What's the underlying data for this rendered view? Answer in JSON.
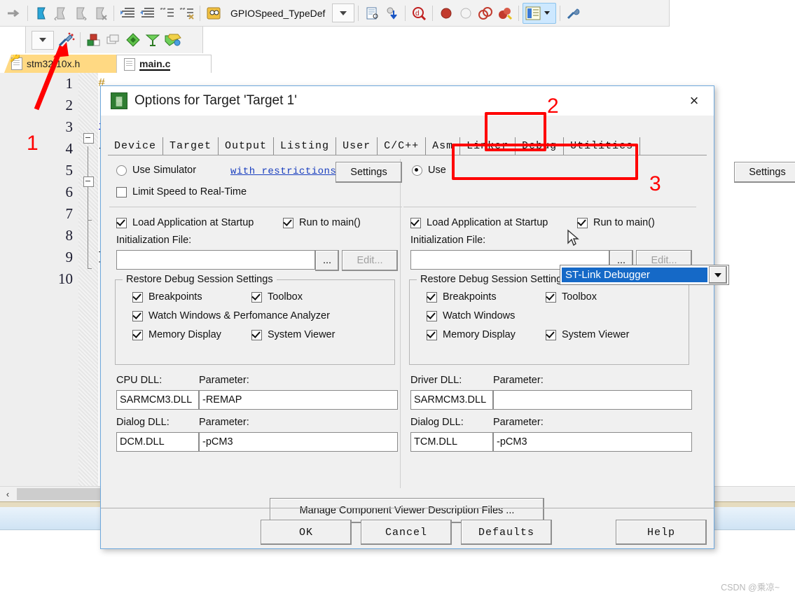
{
  "toolbar": {
    "combo_label": "GPIOSpeed_TypeDef",
    "icons_row1": [
      "step-arrow-icon",
      "bookmark-blue-icon",
      "bookmark-prev-icon",
      "bookmark-next-icon",
      "bookmark-clear-icon",
      "indent-icon",
      "outdent-icon",
      "comment-icon",
      "uncomment-icon",
      "find-in-files-icon"
    ],
    "icons_row1b": [
      "document-properties-icon",
      "insert-icon",
      "find-target-icon",
      "breakpoint-icon",
      "breakpoint-disable-icon",
      "breakpoint-toggle-icon",
      "breakpoint-kill-icon",
      "project-window-icon",
      "configure-wizard-icon"
    ],
    "icons_row2": [
      "dropdown-icon",
      "build-wizard-icon",
      "target-options-icon",
      "manage-project-icon",
      "batch-build-icon",
      "translate-icon",
      "manage-runtime-icon"
    ]
  },
  "file_tabs": [
    {
      "name": "stm32f10x.h",
      "icon": "key-document-icon",
      "active": false
    },
    {
      "name": "main.c",
      "icon": "document-icon",
      "active": true
    }
  ],
  "editor": {
    "line_numbers": [
      "1",
      "2",
      "3",
      "4",
      "5",
      "6",
      "7",
      "8",
      "9",
      "10"
    ],
    "code_lines": [
      "#",
      "",
      "i",
      "{",
      "",
      "",
      "",
      "",
      "}",
      ""
    ],
    "scroll_left_arrow": "‹"
  },
  "dialog": {
    "title": "Options for Target 'Target 1'",
    "title_icon": "keil-logo-icon",
    "close_icon": "×",
    "tabs": [
      {
        "label": "Device",
        "active": false
      },
      {
        "label": "Target",
        "active": false
      },
      {
        "label": "Output",
        "active": false
      },
      {
        "label": "Listing",
        "active": false
      },
      {
        "label": "User",
        "active": false
      },
      {
        "label": "C/C++",
        "active": false
      },
      {
        "label": "Asm",
        "active": false
      },
      {
        "label": "Linker",
        "active": false
      },
      {
        "label": "Debug",
        "active": true
      },
      {
        "label": "Utilities",
        "active": false
      }
    ],
    "left": {
      "use_simulator_label": "Use Simulator",
      "use_simulator_checked": false,
      "with_restrictions_link": "with restrictions",
      "settings_label": "Settings",
      "limit_speed_label": "Limit Speed to Real-Time",
      "limit_speed_checked": false,
      "load_app_label": "Load Application at Startup",
      "load_app_checked": true,
      "run_to_main_label": "Run to main()",
      "run_to_main_checked": true,
      "init_file_label": "Initialization File:",
      "init_file_value": "",
      "browse_label": "...",
      "edit_label": "Edit...",
      "restore_group_title": "Restore Debug Session Settings",
      "restore_items": [
        {
          "label": "Breakpoints",
          "checked": true
        },
        {
          "label": "Toolbox",
          "checked": true
        },
        {
          "label": "Watch Windows & Perfomance Analyzer",
          "checked": true
        },
        {
          "label": "Memory Display",
          "checked": true
        },
        {
          "label": "System Viewer",
          "checked": true
        }
      ],
      "cpu_dll_label": "CPU DLL:",
      "cpu_dll_value": "SARMCM3.DLL",
      "cpu_param_label": "Parameter:",
      "cpu_param_value": "-REMAP",
      "dialog_dll_label": "Dialog DLL:",
      "dialog_dll_value": "DCM.DLL",
      "dialog_param_label": "Parameter:",
      "dialog_param_value": "-pCM3"
    },
    "right": {
      "use_label": "Use",
      "use_checked": true,
      "debugger_selected": "ST-Link Debugger",
      "settings_label": "Settings",
      "load_app_label": "Load Application at Startup",
      "load_app_checked": true,
      "run_to_main_label": "Run to main()",
      "run_to_main_checked": true,
      "init_file_label": "Initialization File:",
      "init_file_value": "",
      "browse_label": "...",
      "edit_label": "Edit...",
      "restore_group_title": "Restore Debug Session Settings",
      "restore_items": [
        {
          "label": "Breakpoints",
          "checked": true
        },
        {
          "label": "Toolbox",
          "checked": true
        },
        {
          "label": "Watch Windows",
          "checked": true
        },
        {
          "label": "Memory Display",
          "checked": true
        },
        {
          "label": "System Viewer",
          "checked": true
        }
      ],
      "driver_dll_label": "Driver DLL:",
      "driver_dll_value": "SARMCM3.DLL",
      "driver_param_label": "Parameter:",
      "driver_param_value": "",
      "dialog_dll_label": "Dialog DLL:",
      "dialog_dll_value": "TCM.DLL",
      "dialog_param_label": "Parameter:",
      "dialog_param_value": "-pCM3"
    },
    "manage_button_label": "Manage Component Viewer Description Files ...",
    "footer_buttons": [
      {
        "label": "OK"
      },
      {
        "label": "Cancel"
      },
      {
        "label": "Defaults"
      },
      {
        "label": "Help"
      }
    ]
  },
  "annotations": {
    "accent_color": "#ff0000",
    "markers": [
      {
        "number": "1"
      },
      {
        "number": "2"
      },
      {
        "number": "3"
      }
    ]
  },
  "watermark": "CSDN @乘凉~"
}
